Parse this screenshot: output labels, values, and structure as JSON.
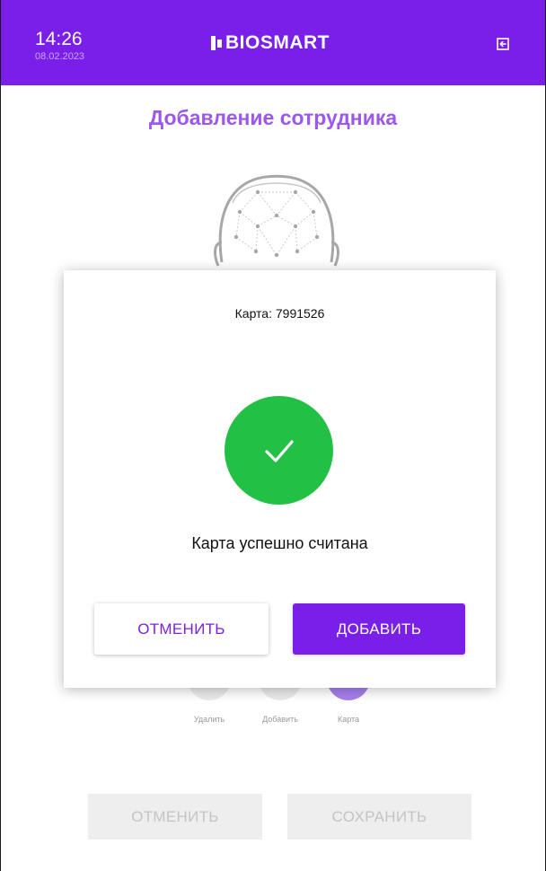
{
  "header": {
    "time": "14:26",
    "date": "08.02.2023",
    "brand": "BIOSMART",
    "logout_icon": "logout-icon",
    "color": "#7a1fe8"
  },
  "page": {
    "title": "Добавление сотрудника",
    "face_icon": "face-scan-icon"
  },
  "actions": [
    {
      "label": "Удалить",
      "icon": "delete-icon"
    },
    {
      "label": "Добавить",
      "icon": "fingerprint-icon"
    },
    {
      "label": "Карта",
      "icon": "card-icon"
    }
  ],
  "footer": {
    "cancel_label": "ОТМЕНИТЬ",
    "save_label": "СОХРАНИТЬ"
  },
  "dialog": {
    "card_text": "Карта: 7991526",
    "status_icon": "checkmark-icon",
    "status_color": "#22c146",
    "message": "Карта успешно считана",
    "cancel_label": "ОТМЕНИТЬ",
    "add_label": "ДОБАВИТЬ"
  }
}
